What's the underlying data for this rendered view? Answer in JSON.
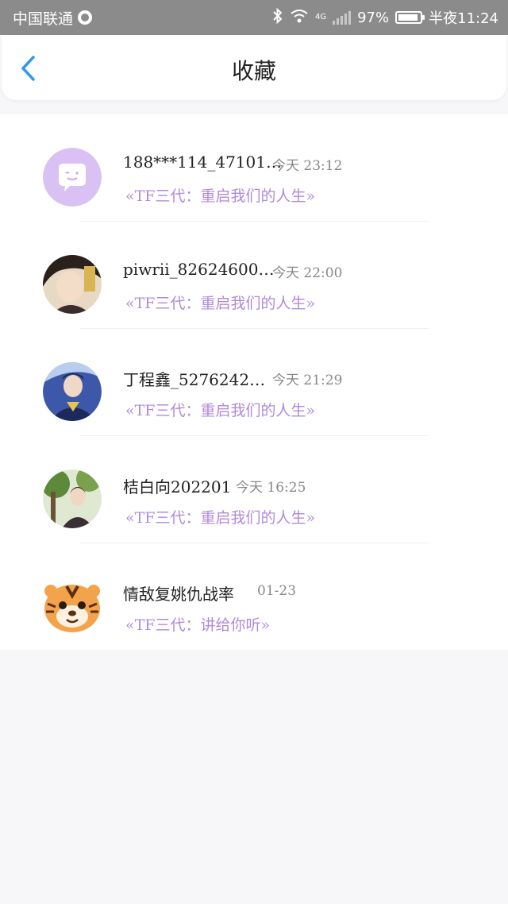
{
  "status_bar": {
    "carrier": "中国联通",
    "network": "4G",
    "battery": "97%",
    "time": "半夜11:24"
  },
  "header": {
    "title": "收藏"
  },
  "favorites": [
    {
      "name": "188***114_47101…",
      "time": "今天 23:12",
      "book": "«TF三代：重启我们的人生»",
      "avatar": "chat-bubble-avatar"
    },
    {
      "name": "piwrii_82624600…",
      "time": "今天 22:00",
      "book": "«TF三代：重启我们的人生»",
      "avatar": "user-photo-avatar"
    },
    {
      "name": "丁程鑫_5276242…",
      "time": "今天 21:29",
      "book": "«TF三代：重启我们的人生»",
      "avatar": "user-photo-avatar"
    },
    {
      "name": "桔白向202201",
      "time": "今天 16:25",
      "book": "«TF三代：重启我们的人生»",
      "avatar": "user-photo-avatar"
    },
    {
      "name": "情敌复姚仇战率",
      "time": "01-23",
      "book": "«TF三代：讲给你听»",
      "avatar": "tiger-avatar"
    }
  ],
  "colors": {
    "accent_purple": "#b18ad8",
    "back_blue": "#2f9be8",
    "status_bar_gray": "#8b8b8b"
  }
}
